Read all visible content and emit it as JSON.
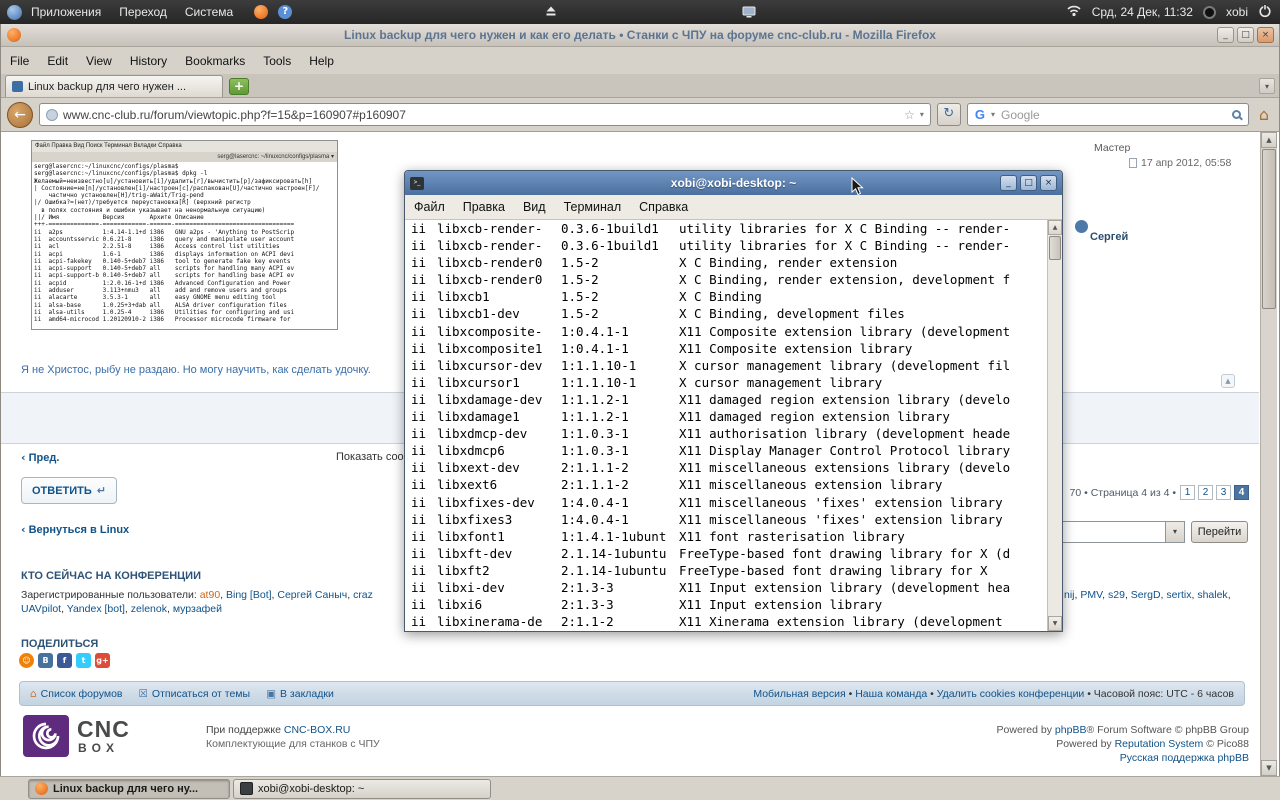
{
  "top_panel": {
    "menus": [
      "Приложения",
      "Переход",
      "Система"
    ],
    "clock": "Срд, 24 Дек, 11:32",
    "user": "xobi"
  },
  "window_buttons": [
    "_",
    "□",
    "×"
  ],
  "firefox": {
    "title": "Linux backup для чего нужен и как его делать • Станки с ЧПУ на форуме cnc-club.ru - Mozilla Firefox",
    "menus": [
      "File",
      "Edit",
      "View",
      "History",
      "Bookmarks",
      "Tools",
      "Help"
    ],
    "tab_title": "Linux backup для чего нужен ...",
    "url": "www.cnc-club.ru/forum/viewtopic.php?f=15&p=160907#p160907",
    "search_text": "Google"
  },
  "page": {
    "post": {
      "rank": "Мастер",
      "date": "17 апр 2012, 05:58",
      "author": "Сергей",
      "signature": "Я не Христос, рыбу не раздаю. Но могу научить, как сделать удочку."
    },
    "topic_nav": {
      "prev_arrow": "‹",
      "prev": "Пред.",
      "display": "Показать сообщения за:",
      "reply": "ОТВЕТИТЬ",
      "reply_glyph": "↵",
      "pag_prefix": "70 • Страница 4 из 4 •",
      "pages": [
        {
          "t": "1"
        },
        {
          "t": "2"
        },
        {
          "t": "3"
        },
        {
          "t": "4",
          "cls": "current"
        }
      ],
      "back_arrow": "‹",
      "back": "Вернуться в Linux",
      "goto": "Перейти",
      "top_glyph": "▲"
    },
    "whois": {
      "header": "КТО СЕЙЧАС НА КОНФЕРЕНЦИИ",
      "line1": [
        {
          "t": "Зарегистрированные пользователи: ",
          "c": "#333333"
        },
        {
          "t": "at90",
          "c": "#c9671d",
          "i": true
        },
        {
          "t": ", ",
          "c": "#333333"
        },
        {
          "t": "Bing [Bot]",
          "c": "#105289",
          "i": true
        },
        {
          "t": ", ",
          "c": "#333333"
        },
        {
          "t": "Сергей Саныч",
          "c": "#105289",
          "i": true
        },
        {
          "t": ", ",
          "c": "#333333"
        },
        {
          "t": "craz",
          "c": "#105289",
          "i": true
        }
      ],
      "line1_right": [
        {
          "t": "nij",
          "c": "#105289",
          "i": true
        },
        {
          "t": ", ",
          "c": "#333333"
        },
        {
          "t": "PMV",
          "c": "#105289",
          "i": true
        },
        {
          "t": ", ",
          "c": "#333333"
        },
        {
          "t": "s29",
          "c": "#105289",
          "i": true
        },
        {
          "t": ", ",
          "c": "#333333"
        },
        {
          "t": "SergD",
          "c": "#105289",
          "i": true
        },
        {
          "t": ", ",
          "c": "#333333"
        },
        {
          "t": "sertix",
          "c": "#105289",
          "i": true
        },
        {
          "t": ", ",
          "c": "#333333"
        },
        {
          "t": "shalek",
          "c": "#105289",
          "i": true
        },
        {
          "t": ",",
          "c": "#333333"
        }
      ],
      "line2": [
        {
          "t": "UAVpilot",
          "c": "#105289",
          "i": true
        },
        {
          "t": ", ",
          "c": "#333333"
        },
        {
          "t": "Yandex [bot]",
          "c": "#105289",
          "i": true
        },
        {
          "t": ", ",
          "c": "#333333"
        },
        {
          "t": "zelenok",
          "c": "#105289",
          "i": true
        },
        {
          "t": ", ",
          "c": "#333333"
        },
        {
          "t": "мурзафей",
          "c": "#105289",
          "i": true
        }
      ]
    },
    "share": {
      "header": "ПОДЕЛИТЬСЯ",
      "icons": [
        {
          "g": "☺",
          "bg": "#ee8208",
          "cls": "round"
        },
        {
          "g": "В",
          "bg": "#48729e"
        },
        {
          "g": "f",
          "bg": "#3b5998"
        },
        {
          "g": "t",
          "bg": "#33ccff"
        },
        {
          "g": "g+",
          "bg": "#dd4b39"
        }
      ]
    },
    "footer_bar": {
      "links": [
        {
          "icon": "⌂",
          "ic": "#c77b3e",
          "t": "Список форумов"
        },
        {
          "icon": "☒",
          "ic": "#4a76a2",
          "t": "Отписаться от темы"
        },
        {
          "icon": "▣",
          "ic": "#4a76a2",
          "t": "В закладки"
        }
      ],
      "right": [
        {
          "t": "Мобильная версия",
          "c": "#105289",
          "i": true
        },
        {
          "t": " • ",
          "c": "#333333"
        },
        {
          "t": "Наша команда",
          "c": "#105289",
          "i": true
        },
        {
          "t": " • ",
          "c": "#333333"
        },
        {
          "t": "Удалить cookies конференции",
          "c": "#105289",
          "i": true
        },
        {
          "t": " • Часовой пояс: UTC - 6 часов",
          "c": "#333333"
        }
      ]
    },
    "footer": {
      "logo_top": "CNC",
      "logo_bottom": "BOX",
      "support": [
        {
          "t": "При поддержке ",
          "c": "#444444"
        },
        {
          "t": "CNC-BOX.RU",
          "c": "#105289",
          "i": true
        }
      ],
      "support2": "Комплектующие для станков с ЧПУ",
      "credit1": [
        {
          "t": "Powered by ",
          "c": "#555555"
        },
        {
          "t": "phpBB",
          "c": "#105289",
          "i": true
        },
        {
          "t": "® Forum Software © phpBB Group",
          "c": "#555555"
        }
      ],
      "credit2": [
        {
          "t": "Powered by ",
          "c": "#555555"
        },
        {
          "t": "Reputation System",
          "c": "#105289",
          "i": true
        },
        {
          "t": " © Pico88",
          "c": "#555555"
        }
      ],
      "credit3": [
        {
          "t": "Русская поддержка phpBB",
          "c": "#105289",
          "i": true
        }
      ]
    },
    "inner_shot": {
      "menubar": "Файл Правка Вид Поиск Терминал Вкладки Справка",
      "tab": "serg@lasercnc: ~/linuxcnc/configs/plasma ▾",
      "lines": [
        "serg@lasercnc:~/linuxcnc/configs/plasma$",
        "serg@lasercnc:~/linuxcnc/configs/plasma$ dpkg -l",
        "Желаемый=неизвестно[u]/установить[i]/удалить[r]/вычистить[p]/зафиксировать[h]",
        "| Состояние=не[n]/установлен[i]/настроен[c]/распакован[U]/частично настроен[F]/",
        "    частично установлен[H]/trig-aWait/Trig-pend",
        "|/ Ошибка?=(нет)/требуется переустановка[R] (верхний регистр",
        "  в полях состояния и ошибки указывает на ненормальную ситуацию)",
        "||/ Имя            Версия       Архите Описание",
        "+++-==============-============-======-=================================",
        "ii  a2ps           1:4.14-1.1+d i386   GNU a2ps - 'Anything to PostScrip",
        "ii  accountsservic 0.6.21-8     i386   query and manipulate user account",
        "ii  acl            2.2.51-8     i386   Access control list utilities",
        "ii  acpi           1.6-1        i386   displays information on ACPI devi",
        "ii  acpi-fakekey   0.140-5+deb7 i386   tool to generate fake key events",
        "ii  acpi-support   0.140-5+deb7 all    scripts for handling many ACPI ev",
        "ii  acpi-support-b 0.140-5+deb7 all    scripts for handling base ACPI ev",
        "ii  acpid          1:2.0.16-1+d i386   Advanced Configuration and Power",
        "ii  adduser        3.113+nmu3   all    add and remove users and groups",
        "ii  alacarte       3.5.3-1      all    easy GNOME menu editing tool",
        "ii  alsa-base      1.0.25+3+dab all    ALSA driver configuration files",
        "ii  alsa-utils     1.0.25-4     i386   Utilities for configuring and usi",
        "ii  amd64-microcod 1.20120910-2 i386   Processor microcode firmware for"
      ]
    }
  },
  "terminal": {
    "title": "xobi@xobi-desktop: ~",
    "menus": [
      "Файл",
      "Правка",
      "Вид",
      "Терминал",
      "Справка"
    ],
    "rows": [
      {
        "s": "ii",
        "n": "libxcb-render-",
        "v": "0.3.6-1build1",
        "d": "utility libraries for X C Binding -- render-"
      },
      {
        "s": "ii",
        "n": "libxcb-render-",
        "v": "0.3.6-1build1",
        "d": "utility libraries for X C Binding -- render-"
      },
      {
        "s": "ii",
        "n": "libxcb-render0",
        "v": "1.5-2",
        "d": "X C Binding, render extension"
      },
      {
        "s": "ii",
        "n": "libxcb-render0",
        "v": "1.5-2",
        "d": "X C Binding, render extension, development f"
      },
      {
        "s": "ii",
        "n": "libxcb1",
        "v": "1.5-2",
        "d": "X C Binding"
      },
      {
        "s": "ii",
        "n": "libxcb1-dev",
        "v": "1.5-2",
        "d": "X C Binding, development files"
      },
      {
        "s": "ii",
        "n": "libxcomposite-",
        "v": "1:0.4.1-1",
        "d": "X11 Composite extension library (development"
      },
      {
        "s": "ii",
        "n": "libxcomposite1",
        "v": "1:0.4.1-1",
        "d": "X11 Composite extension library"
      },
      {
        "s": "ii",
        "n": "libxcursor-dev",
        "v": "1:1.1.10-1",
        "d": "X cursor management library (development fil"
      },
      {
        "s": "ii",
        "n": "libxcursor1",
        "v": "1:1.1.10-1",
        "d": "X cursor management library"
      },
      {
        "s": "ii",
        "n": "libxdamage-dev",
        "v": "1:1.1.2-1",
        "d": "X11 damaged region extension library (develo"
      },
      {
        "s": "ii",
        "n": "libxdamage1",
        "v": "1:1.1.2-1",
        "d": "X11 damaged region extension library"
      },
      {
        "s": "ii",
        "n": "libxdmcp-dev",
        "v": "1:1.0.3-1",
        "d": "X11 authorisation library (development heade"
      },
      {
        "s": "ii",
        "n": "libxdmcp6",
        "v": "1:1.0.3-1",
        "d": "X11 Display Manager Control Protocol library"
      },
      {
        "s": "ii",
        "n": "libxext-dev",
        "v": "2:1.1.1-2",
        "d": "X11 miscellaneous extensions library (develo"
      },
      {
        "s": "ii",
        "n": "libxext6",
        "v": "2:1.1.1-2",
        "d": "X11 miscellaneous extension library"
      },
      {
        "s": "ii",
        "n": "libxfixes-dev",
        "v": "1:4.0.4-1",
        "d": "X11 miscellaneous 'fixes' extension library"
      },
      {
        "s": "ii",
        "n": "libxfixes3",
        "v": "1:4.0.4-1",
        "d": "X11 miscellaneous 'fixes' extension library"
      },
      {
        "s": "ii",
        "n": "libxfont1",
        "v": "1:1.4.1-1ubunt",
        "d": "X11 font rasterisation library"
      },
      {
        "s": "ii",
        "n": "libxft-dev",
        "v": "2.1.14-1ubuntu",
        "d": "FreeType-based font drawing library for X (d"
      },
      {
        "s": "ii",
        "n": "libxft2",
        "v": "2.1.14-1ubuntu",
        "d": "FreeType-based font drawing library for X"
      },
      {
        "s": "ii",
        "n": "libxi-dev",
        "v": "2:1.3-3",
        "d": "X11 Input extension library (development hea"
      },
      {
        "s": "ii",
        "n": "libxi6",
        "v": "2:1.3-3",
        "d": "X11 Input extension library"
      },
      {
        "s": "ii",
        "n": "libxinerama-de",
        "v": "2:1.1-2",
        "d": "X11 Xinerama extension library (development"
      }
    ]
  },
  "taskbar": {
    "buttons": [
      {
        "t": "Linux backup для чего ну..."
      },
      {
        "t": "xobi@xobi-desktop: ~"
      }
    ]
  }
}
